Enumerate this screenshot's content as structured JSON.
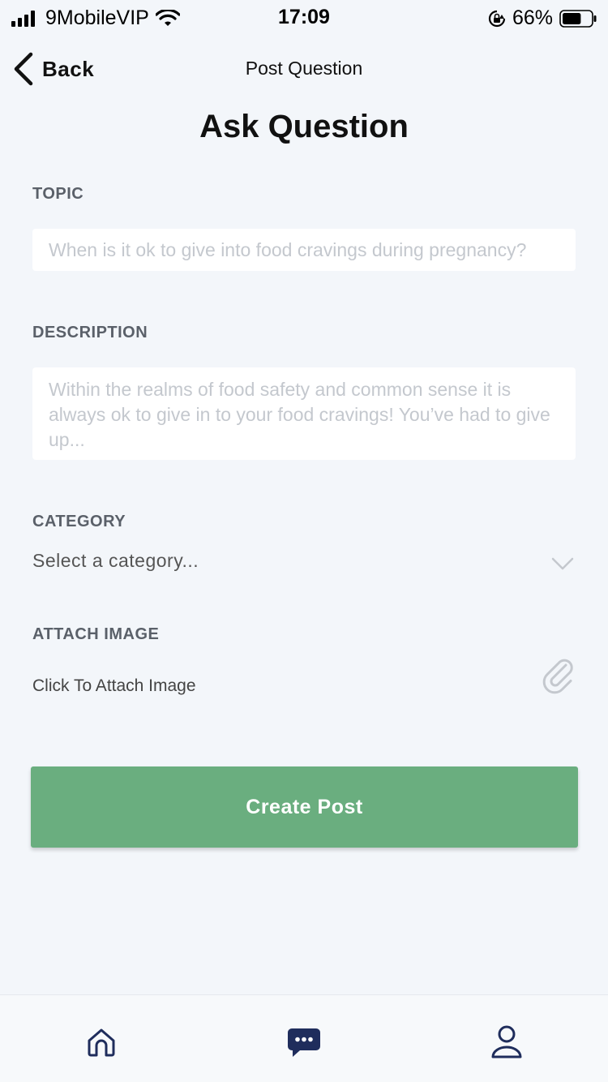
{
  "status_bar": {
    "carrier": "9MobileVIP",
    "time": "17:09",
    "battery_percent": "66%",
    "battery_level": 0.66
  },
  "nav": {
    "back_label": "Back",
    "title": "Post Question"
  },
  "page": {
    "title": "Ask Question"
  },
  "form": {
    "topic": {
      "label": "TOPIC",
      "placeholder": "When is it ok to give into food cravings during pregnancy?"
    },
    "description": {
      "label": "DESCRIPTION",
      "placeholder": "Within the realms of food safety and common sense it is always ok to give in to your food cravings! You’ve had to give up..."
    },
    "category": {
      "label": "CATEGORY",
      "value": "Select a category..."
    },
    "attach_image": {
      "label": "ATTACH IMAGE",
      "action_label": "Click To Attach Image"
    },
    "submit_label": "Create Post"
  },
  "tab_bar": {
    "items": [
      {
        "icon": "home-icon"
      },
      {
        "icon": "chat-bubble-icon",
        "active": true
      },
      {
        "icon": "user-icon"
      }
    ]
  },
  "colors": {
    "background": "#f3f6fa",
    "primary_button": "#6aae7f",
    "active_tab": "#1f2d5c",
    "label_gray": "#5a6069"
  }
}
